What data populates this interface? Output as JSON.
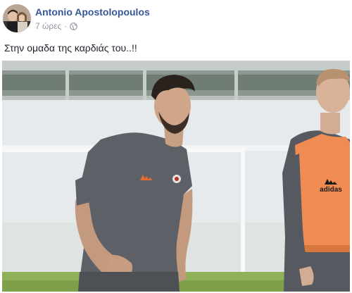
{
  "post": {
    "author_name": "Antonio Apostolopoulos",
    "timestamp": "7 ώρες",
    "separator": "·",
    "privacy_icon": "globe-icon",
    "caption": "Στην ομαδα της καρδιάς του..!!"
  },
  "photo": {
    "kit_brand": "adidas"
  },
  "colors": {
    "author_link": "#365899",
    "meta_text": "#90949c",
    "caption_text": "#1d2129"
  }
}
